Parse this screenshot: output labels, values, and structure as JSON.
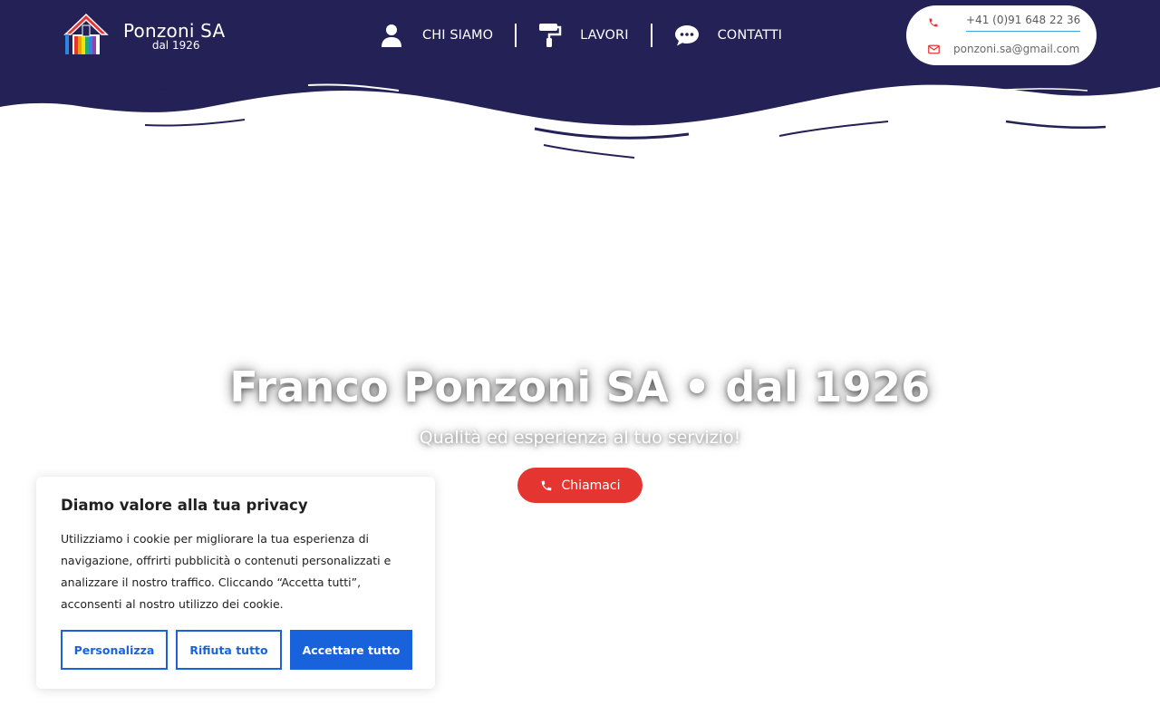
{
  "brand": {
    "name": "Ponzoni SA",
    "since": "dal 1926"
  },
  "nav": {
    "items": [
      {
        "label": "CHI SIAMO",
        "icon": "user-icon"
      },
      {
        "label": "LAVORI",
        "icon": "paint-roller-icon"
      },
      {
        "label": "CONTATTI",
        "icon": "chat-icon"
      }
    ]
  },
  "contact": {
    "phone": "+41 (0)91 648 22 36",
    "email": "ponzoni.sa@gmail.com"
  },
  "hero": {
    "title": "Franco Ponzoni SA • dal 1926",
    "subtitle": "Qualità ed esperienza al tuo servizio!",
    "cta_label": "Chiamaci"
  },
  "cookie": {
    "title": "Diamo valore alla tua privacy",
    "text": "Utilizziamo i cookie per migliorare la tua esperienza di navigazione, offrirti pubblicità o contenuti personalizzati e analizzare il nostro traffico. Cliccando “Accetta tutti”, acconsenti al nostro utilizzo dei cookie.",
    "customize_label": "Personalizza",
    "reject_label": "Rifiuta tutto",
    "accept_label": "Accettare tutto"
  },
  "colors": {
    "header_navy": "#232156",
    "accent_red": "#e53531",
    "cookie_blue": "#1863dc"
  }
}
